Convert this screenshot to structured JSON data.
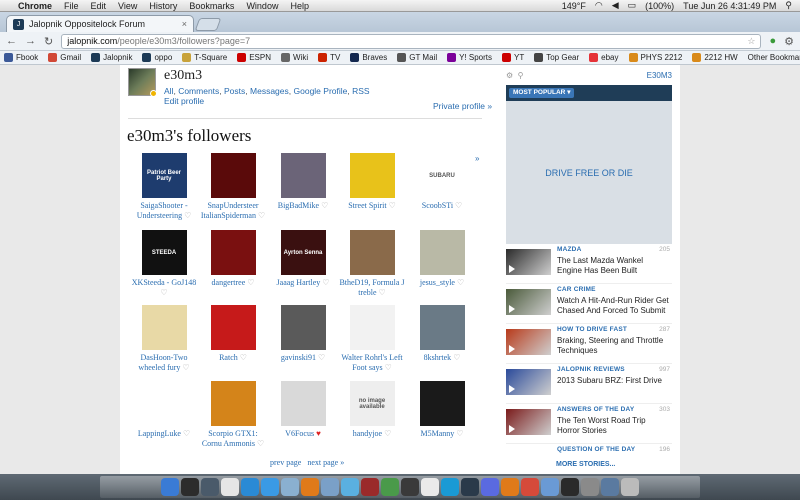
{
  "menubar": {
    "app": "Chrome",
    "items": [
      "File",
      "Edit",
      "View",
      "History",
      "Bookmarks",
      "Window",
      "Help"
    ],
    "temperature": "149°F",
    "battery": "(100%)",
    "clock": "Tue Jun 26  4:31:49 PM"
  },
  "tab": {
    "title": "Jalopnik Oppositelock Forum"
  },
  "address": {
    "host": "jalopnik.com",
    "path": "/people/e30m3/followers?page=7"
  },
  "bookmarks": {
    "items": [
      {
        "label": "Fbook",
        "color": "#3b5998"
      },
      {
        "label": "Gmail",
        "color": "#d14836"
      },
      {
        "label": "Jalopnik",
        "color": "#1c3a56"
      },
      {
        "label": "oppo",
        "color": "#1c3a56"
      },
      {
        "label": "T-Square",
        "color": "#c8a23a"
      },
      {
        "label": "ESPN",
        "color": "#cc0000"
      },
      {
        "label": "Wiki",
        "color": "#666666"
      },
      {
        "label": "TV",
        "color": "#cc2200"
      },
      {
        "label": "Braves",
        "color": "#13274f"
      },
      {
        "label": "GT Mail",
        "color": "#555555"
      },
      {
        "label": "Y! Sports",
        "color": "#7b0099"
      },
      {
        "label": "YT",
        "color": "#cc0000"
      },
      {
        "label": "Top Gear",
        "color": "#444444"
      },
      {
        "label": "ebay",
        "color": "#e53238"
      },
      {
        "label": "PHYS 2212",
        "color": "#d98a1a"
      },
      {
        "label": "2212 HW",
        "color": "#d98a1a"
      }
    ],
    "other": "Other Bookmarks"
  },
  "profile": {
    "username": "e30m3",
    "links": [
      "All",
      "Comments",
      "Posts",
      "Messages",
      "Google Profile",
      "RSS"
    ],
    "edit": "Edit profile",
    "private": "Private profile »"
  },
  "followers": {
    "title": "e30m3's followers",
    "more": "»",
    "items": [
      {
        "name": "SaigaShooter - Understeering",
        "bg": "#1e3c6e",
        "text": "Patriot Beer Party"
      },
      {
        "name": "SnapUndersteer ItalianSpiderman",
        "bg": "#5a0a0a",
        "text": ""
      },
      {
        "name": "BigBadMike",
        "bg": "#6b6478",
        "text": ""
      },
      {
        "name": "Street Spirit",
        "bg": "#e8c21a",
        "text": ""
      },
      {
        "name": "ScoobSTi",
        "bg": "#ffffff",
        "text": "SUBARU"
      },
      {
        "name": "XKSteeda - GoJ148",
        "bg": "#111111",
        "text": "STEEDA"
      },
      {
        "name": "dangertree",
        "bg": "#7a1010",
        "text": ""
      },
      {
        "name": "Jaaag Hartley",
        "bg": "#3a1010",
        "text": "Ayrton Senna"
      },
      {
        "name": "BtheD19, Formula J treble",
        "bg": "#8a6a4a",
        "text": ""
      },
      {
        "name": "jesus_style",
        "bg": "#b9b9a6",
        "text": ""
      },
      {
        "name": "DasHoon-Two wheeled fury",
        "bg": "#e8d9a6",
        "text": ""
      },
      {
        "name": "Ratch",
        "bg": "#c61a1a",
        "text": ""
      },
      {
        "name": "gavinski91",
        "bg": "#5a5a5a",
        "text": ""
      },
      {
        "name": "Walter Rohrl's Left Foot says",
        "bg": "#f2f2f2",
        "text": ""
      },
      {
        "name": "8kshrtek",
        "bg": "#6a7a86",
        "text": ""
      },
      {
        "name": "LappingLuke",
        "bg": "#ffffff",
        "text": ""
      },
      {
        "name": "Scorpio GTX1: Cornu Ammonis",
        "bg": "#d4841a",
        "text": ""
      },
      {
        "name": "V6Focus",
        "bg": "#d9d9d9",
        "text": ""
      },
      {
        "name": "handyjoe",
        "bg": "#eeeeee",
        "text": "no image available"
      },
      {
        "name": "M5Manny",
        "bg": "#1a1a1a",
        "text": ""
      }
    ],
    "red_heart_index": 17
  },
  "pager": {
    "prev": "prev page",
    "next": "next page »"
  },
  "sidebar": {
    "user": "E30M3",
    "dropdown": "MOST POPULAR",
    "ad": "DRIVE FREE OR DIE",
    "stories": [
      {
        "category": "MAZDA",
        "count": "205",
        "headline": "The Last Mazda Wankel Engine Has Been Built",
        "color": "#2a2a2a"
      },
      {
        "category": "CAR CRIME",
        "count": "",
        "headline": "Watch A Hit-And-Run Rider Get Chased And Forced To Submit",
        "color": "#4a5a3a"
      },
      {
        "category": "HOW TO DRIVE FAST",
        "count": "287",
        "headline": "Braking, Steering and Throttle Techniques",
        "color": "#b83a1a"
      },
      {
        "category": "JALOPNIK REVIEWS",
        "count": "997",
        "headline": "2013 Subaru BRZ: First Drive",
        "color": "#2a4a9a"
      },
      {
        "category": "ANSWERS OF THE DAY",
        "count": "303",
        "headline": "The Ten Worst Road Trip Horror Stories",
        "color": "#7a1a1a"
      },
      {
        "category": "QUESTION OF THE DAY",
        "count": "196",
        "headline": "",
        "color": "#3a3a3a"
      }
    ],
    "more": "MORE STORIES..."
  },
  "dock": {
    "icons": [
      {
        "name": "finder-icon",
        "c": "#3a7bd5"
      },
      {
        "name": "dashboard-icon",
        "c": "#2c2c2c"
      },
      {
        "name": "mission-control-icon",
        "c": "#4a5a6a"
      },
      {
        "name": "calendar-icon",
        "c": "#e6e6e6"
      },
      {
        "name": "safari-icon",
        "c": "#2a8ad5"
      },
      {
        "name": "app-store-icon",
        "c": "#3a9ae5"
      },
      {
        "name": "preview-icon",
        "c": "#8ab0d0"
      },
      {
        "name": "firefox-icon",
        "c": "#e07a1a"
      },
      {
        "name": "mail-icon",
        "c": "#7aa0c8"
      },
      {
        "name": "itunes-icon",
        "c": "#5ab0e0"
      },
      {
        "name": "photo-booth-icon",
        "c": "#9a2a2a"
      },
      {
        "name": "chrome-icon",
        "c": "#4a9a4a"
      },
      {
        "name": "x11-icon",
        "c": "#3a3a3a"
      },
      {
        "name": "textedit-icon",
        "c": "#eaeaea"
      },
      {
        "name": "skype-icon",
        "c": "#1a9ad5"
      },
      {
        "name": "steam-icon",
        "c": "#2a3a4a"
      },
      {
        "name": "itunes-2-icon",
        "c": "#5a6ae0"
      },
      {
        "name": "vlc-icon",
        "c": "#e07a1a"
      },
      {
        "name": "chrome-2-icon",
        "c": "#d54a3a"
      },
      {
        "name": "folder-icon",
        "c": "#6a9ad5"
      },
      {
        "name": "terminal-icon",
        "c": "#2a2a2a"
      },
      {
        "name": "utilities-icon",
        "c": "#8a8a8a"
      },
      {
        "name": "downloads-icon",
        "c": "#5a7aa0"
      },
      {
        "name": "trash-icon",
        "c": "#bbbbbb"
      }
    ]
  }
}
